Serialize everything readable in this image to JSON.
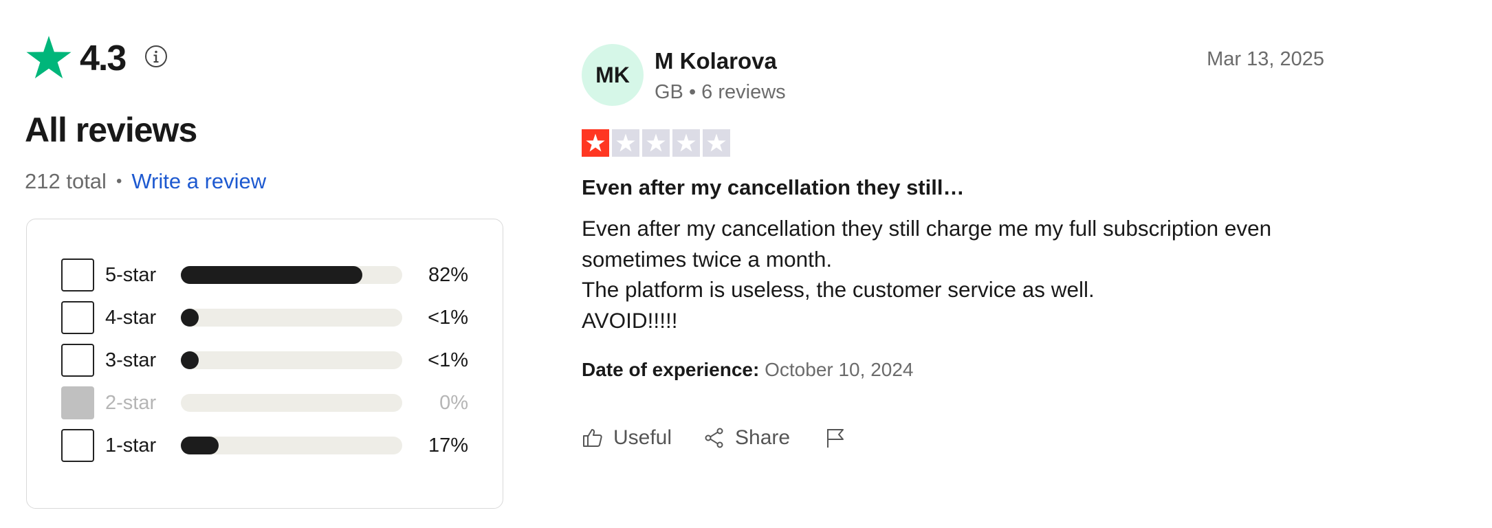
{
  "summary": {
    "rating": "4.3",
    "title": "All reviews",
    "total": "212 total",
    "separator": "•",
    "write_review": "Write a review",
    "accent_color": "#00b67a",
    "link_color": "#1d59d0"
  },
  "distribution": [
    {
      "label": "5-star",
      "percent": "82%",
      "fill_fraction": 0.82,
      "enabled": true
    },
    {
      "label": "4-star",
      "percent": "<1%",
      "fill_fraction": 0.004,
      "enabled": true
    },
    {
      "label": "3-star",
      "percent": "<1%",
      "fill_fraction": 0.004,
      "enabled": true
    },
    {
      "label": "2-star",
      "percent": "0%",
      "fill_fraction": 0,
      "enabled": false
    },
    {
      "label": "1-star",
      "percent": "17%",
      "fill_fraction": 0.17,
      "enabled": true
    }
  ],
  "review": {
    "avatar_initials": "MK",
    "avatar_color": "#d6f7e8",
    "reviewer_name": "M Kolarova",
    "reviewer_meta": "GB • 6 reviews",
    "date": "Mar 13, 2025",
    "star_rating": 1,
    "star_color": "#ff3722",
    "title": "Even after my cancellation they still…",
    "body": [
      "Even after my cancellation they still charge me my full subscription even sometimes twice a month.",
      "The platform is useless, the customer service as well.",
      "AVOID!!!!!"
    ],
    "experience_label": "Date of experience:",
    "experience_date": "October 10, 2024",
    "actions": {
      "useful": "Useful",
      "share": "Share"
    }
  },
  "icons": [
    "trustpilot-star-icon",
    "info-icon",
    "thumbs-up-icon",
    "share-icon",
    "flag-icon"
  ]
}
